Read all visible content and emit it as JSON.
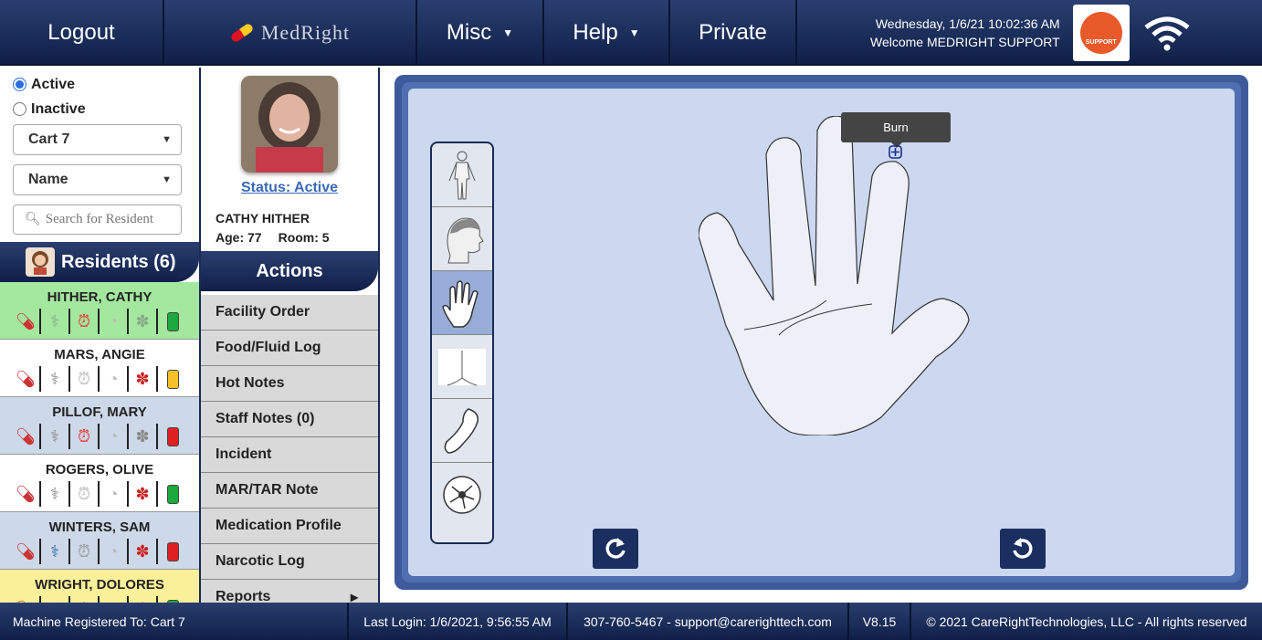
{
  "header": {
    "logout": "Logout",
    "logo": "MedRight",
    "misc": "Misc",
    "help": "Help",
    "private": "Private",
    "datetime": "Wednesday, 1/6/21 10:02:36 AM",
    "welcome": "Welcome MEDRIGHT SUPPORT",
    "support": "SUPPORT"
  },
  "filters": {
    "active": "Active",
    "inactive": "Inactive",
    "cart": "Cart 7",
    "sort": "Name",
    "search_placeholder": "Search for Resident"
  },
  "residents_header": "Residents (6)",
  "residents": [
    {
      "name": "HITHER, CATHY",
      "bg": "#a4e8a0",
      "status": "#1ca83c"
    },
    {
      "name": "MARS, ANGIE",
      "bg": "#ffffff",
      "status": "#f5c02a"
    },
    {
      "name": "PILLOF, MARY",
      "bg": "#cdd8e8",
      "status": "#e02020"
    },
    {
      "name": "ROGERS, OLIVE",
      "bg": "#ffffff",
      "status": "#1ca83c"
    },
    {
      "name": "WINTERS, SAM",
      "bg": "#cdd8e8",
      "status": "#e02020"
    },
    {
      "name": "WRIGHT, DOLORES",
      "bg": "#fbf09a",
      "status": "#1ca83c"
    }
  ],
  "patient": {
    "status": "Status: Active",
    "name": "CATHY HITHER",
    "age": "Age: 77",
    "room": "Room: 5"
  },
  "actions_header": "Actions",
  "actions": [
    "Facility Order",
    "Food/Fluid Log",
    "Hot Notes",
    "Staff Notes (0)",
    "Incident",
    "MAR/TAR Note",
    "Medication Profile",
    "Narcotic Log",
    "Reports"
  ],
  "body_map": {
    "tooltip": "Burn"
  },
  "footer": {
    "machine": "Machine Registered To: Cart 7",
    "last_login": "Last Login: 1/6/2021, 9:56:55 AM",
    "contact": "307-760-5467 - support@carerighttech.com",
    "version": "V8.15",
    "copyright": "© 2021 CareRightTechnologies, LLC - All rights reserved"
  }
}
